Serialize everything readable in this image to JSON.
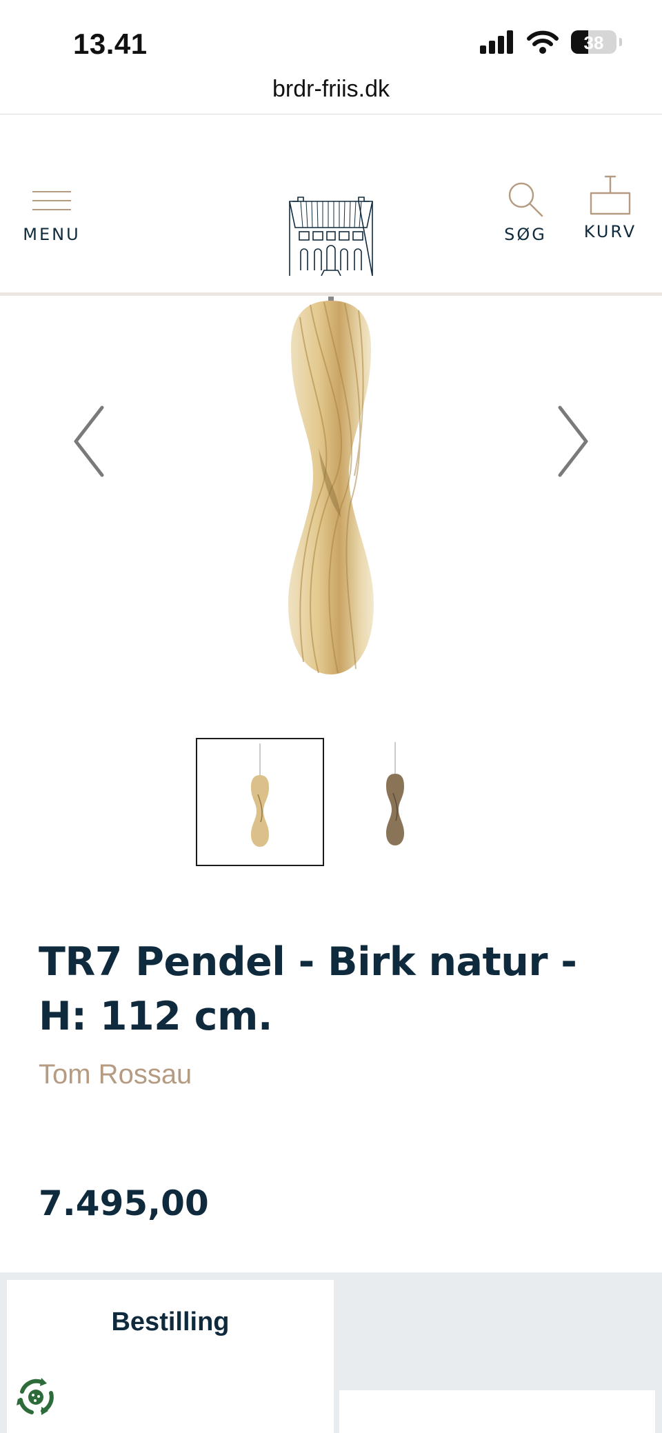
{
  "status_bar": {
    "time": "13.41",
    "battery_percent": "38",
    "battery_level": 0.38
  },
  "browser": {
    "url": "brdr-friis.dk"
  },
  "header": {
    "menu_label": "MENU",
    "search_label": "SØG",
    "cart_label": "KURV",
    "logo_icon": "house-facade-logo"
  },
  "gallery": {
    "prev_icon": "chevron-left-icon",
    "next_icon": "chevron-right-icon",
    "thumbnail_count": 2,
    "selected_thumbnail": 1
  },
  "product": {
    "title": "TR7 Pendel - Birk natur - H: 112 cm.",
    "brand": "Tom Rossau",
    "price": "7.495,00"
  },
  "tabs": [
    {
      "label": "Bestilling",
      "active": true
    },
    {
      "label": "",
      "active": false
    }
  ],
  "colors": {
    "navy": "#0f2a3d",
    "brand_tan": "#b59b82",
    "header_line": "#ece6e1",
    "tab_bg": "#e9ecef",
    "eco_green": "#2e6b3a"
  }
}
